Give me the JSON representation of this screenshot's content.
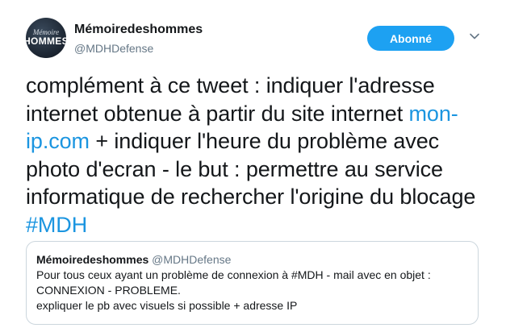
{
  "header": {
    "avatar_line1": "Mémoire",
    "avatar_line2": "HOMMES",
    "display_name": "Mémoiredeshommes",
    "handle": "@MDHDefense",
    "follow_label": "Abonné",
    "menu_icon": "chevron-down-icon"
  },
  "tweet": {
    "text_part1": "complément à ce tweet : indiquer l'adresse internet obtenue à partir du site internet ",
    "link": "mon-ip.com",
    "text_part2": " + indiquer l'heure du problème avec photo d'ecran  - le but : permettre au service informatique de rechercher l'origine du blocage ",
    "hashtag": "#MDH"
  },
  "quoted": {
    "display_name": "Mémoiredeshommes",
    "handle": "@MDHDefense",
    "line1": "Pour tous ceux ayant un problème de connexion à #MDH - mail avec en objet :",
    "line2": "CONNEXION - PROBLEME.",
    "line3": "expliquer le pb avec visuels si possible + adresse IP"
  },
  "colors": {
    "accent": "#1da1f2",
    "link": "#1b95e0",
    "secondary_text": "#657786",
    "border": "#ccd6dd"
  }
}
